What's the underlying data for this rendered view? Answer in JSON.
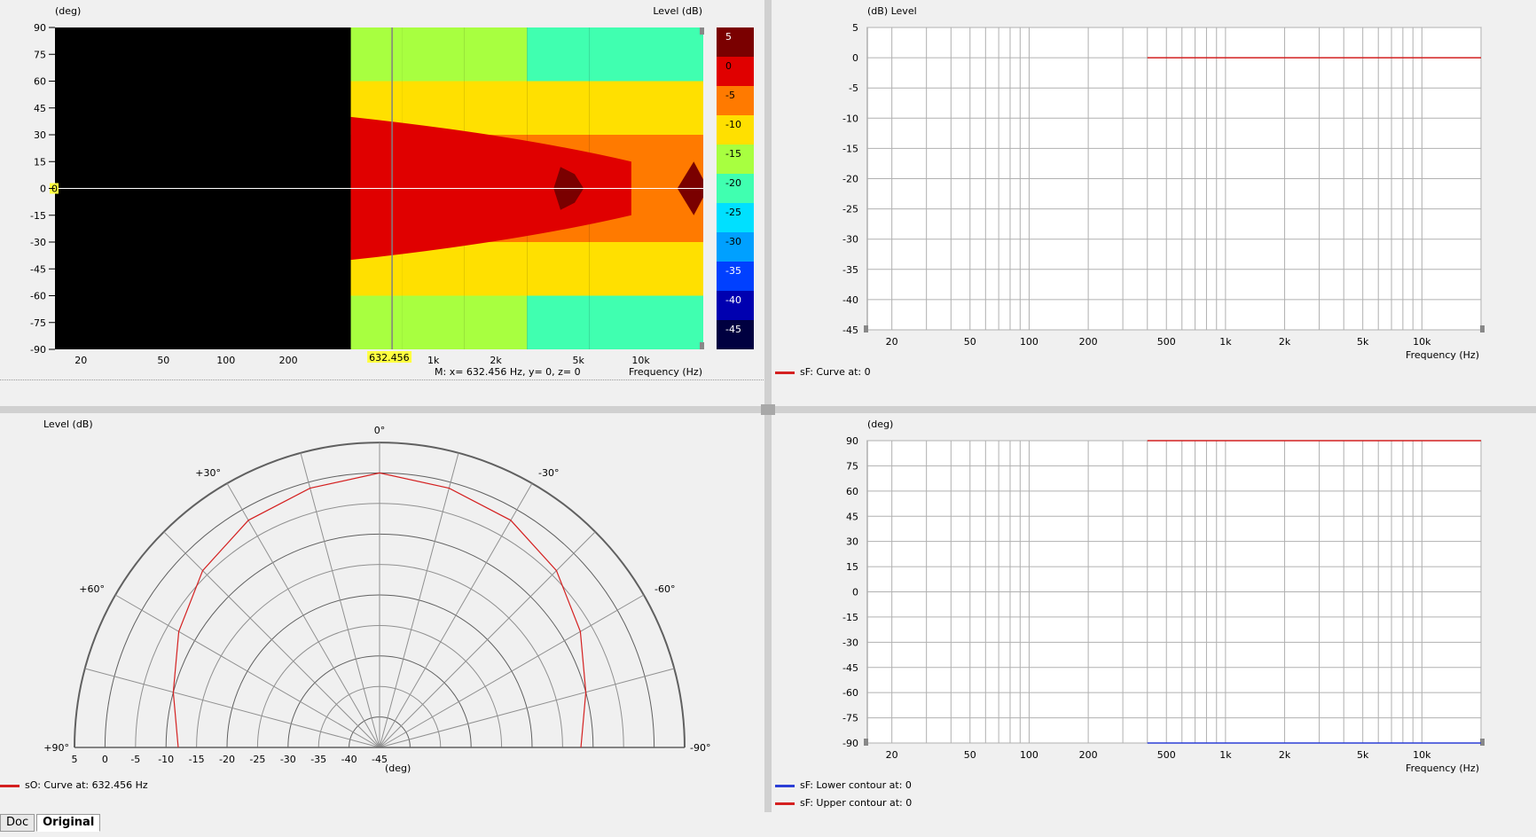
{
  "tabs": [
    {
      "label": "Doc",
      "active": false
    },
    {
      "label": "Original",
      "active": true
    }
  ],
  "colors": {
    "curve": "#d42020",
    "lower": "#2b3ed6",
    "upper": "#d42020"
  },
  "contour": {
    "ylabel": "(deg)",
    "zlabel": "Level  (dB)",
    "xlabel": "Frequency  (Hz)",
    "yticks": [
      "90",
      "75",
      "60",
      "45",
      "30",
      "15",
      "0",
      "-15",
      "-30",
      "-45",
      "-60",
      "-75",
      "-90"
    ],
    "xticks": [
      "20",
      "50",
      "100",
      "200",
      "1k",
      "2k",
      "5k",
      "10k"
    ],
    "cursor_x": "632.456",
    "cursor_y": "0",
    "marker_text": "M:  x= 632.456 Hz,  y= 0,  z= 0",
    "colorbar": {
      "labels": [
        "5",
        "0",
        "-5",
        "-10",
        "-15",
        "-20",
        "-25",
        "-30",
        "-35",
        "-40",
        "-45"
      ],
      "colors": [
        "#7a0000",
        "#e00000",
        "#ff7a00",
        "#ffe000",
        "#a8ff40",
        "#40ffb0",
        "#00e0ff",
        "#00a0ff",
        "#0040ff",
        "#0000b0",
        "#000040"
      ]
    }
  },
  "level_chart": {
    "ylabel": "(dB)  Level",
    "xlabel": "Frequency  (Hz)",
    "yticks": [
      "5",
      "0",
      "-5",
      "-10",
      "-15",
      "-20",
      "-25",
      "-30",
      "-35",
      "-40",
      "-45"
    ],
    "xticks": [
      "20",
      "50",
      "100",
      "200",
      "500",
      "1k",
      "2k",
      "5k",
      "10k"
    ],
    "legend": "sF: Curve at: 0"
  },
  "polar_chart": {
    "title": "Level  (dB)",
    "angle_labels": [
      "0°",
      "+30°",
      "-30°",
      "+60°",
      "-60°",
      "+90°",
      "-90°"
    ],
    "radial_labels": [
      "5",
      "0",
      "-5",
      "-10",
      "-15",
      "-20",
      "-25",
      "-30",
      "-35",
      "-40",
      "-45"
    ],
    "unit": "(deg)",
    "legend": "sO: Curve at: 632.456 Hz"
  },
  "phase_chart": {
    "ylabel": "(deg)",
    "xlabel": "Frequency  (Hz)",
    "yticks": [
      "90",
      "75",
      "60",
      "45",
      "30",
      "15",
      "0",
      "-15",
      "-30",
      "-45",
      "-60",
      "-75",
      "-90"
    ],
    "xticks": [
      "20",
      "50",
      "100",
      "200",
      "500",
      "1k",
      "2k",
      "5k",
      "10k"
    ],
    "legend_lower": "sF: Lower contour at: 0",
    "legend_upper": "sF: Upper contour at: 0"
  },
  "chart_data": [
    {
      "type": "heatmap",
      "title": "",
      "xlabel": "Frequency  (Hz)",
      "ylabel": "(deg)",
      "zlabel": "Level  (dB)",
      "x_scale": "log",
      "xlim": [
        15,
        20000
      ],
      "ylim": [
        -90,
        90
      ],
      "zlim": [
        -45,
        5
      ],
      "x": [
        500,
        1000,
        2000,
        4000,
        8000
      ],
      "y": [
        90,
        60,
        30,
        0,
        -30,
        -60,
        -90
      ],
      "z": [
        [
          -15,
          -20,
          -20,
          -25,
          -20
        ],
        [
          -10,
          -10,
          -10,
          -15,
          -15
        ],
        [
          -5,
          -5,
          -5,
          -5,
          -5
        ],
        [
          -5,
          -5,
          -5,
          0,
          0
        ],
        [
          -5,
          -5,
          -5,
          -5,
          -5
        ],
        [
          -10,
          -10,
          -10,
          -15,
          -15
        ],
        [
          -15,
          -20,
          -20,
          -25,
          -20
        ]
      ]
    },
    {
      "type": "line",
      "title": "",
      "xlabel": "Frequency  (Hz)",
      "ylabel": "(dB)  Level",
      "x_scale": "log",
      "xlim": [
        15,
        20000
      ],
      "ylim": [
        -45,
        5
      ],
      "series": [
        {
          "name": "sF: Curve at: 0",
          "x": [
            400,
            20000
          ],
          "y": [
            0,
            0
          ]
        }
      ]
    },
    {
      "type": "line",
      "title": "Level  (dB)",
      "polar": true,
      "angle_range": [
        -90,
        90
      ],
      "r_range": [
        -45,
        5
      ],
      "series": [
        {
          "name": "sO: Curve at: 632.456 Hz",
          "angle": [
            -90,
            -75,
            -60,
            -45,
            -30,
            -15,
            0,
            15,
            30,
            45,
            60,
            75,
            90
          ],
          "r": [
            -12,
            -10,
            -7,
            -4,
            -2,
            -1,
            0,
            -1,
            -2,
            -4,
            -7,
            -10,
            -12
          ]
        }
      ]
    },
    {
      "type": "line",
      "title": "",
      "xlabel": "Frequency  (Hz)",
      "ylabel": "(deg)",
      "x_scale": "log",
      "xlim": [
        15,
        20000
      ],
      "ylim": [
        -90,
        90
      ],
      "series": [
        {
          "name": "sF: Lower contour at: 0",
          "x": [
            400,
            20000
          ],
          "y": [
            -90,
            -90
          ]
        },
        {
          "name": "sF: Upper contour at: 0",
          "x": [
            400,
            20000
          ],
          "y": [
            90,
            90
          ]
        }
      ]
    }
  ]
}
